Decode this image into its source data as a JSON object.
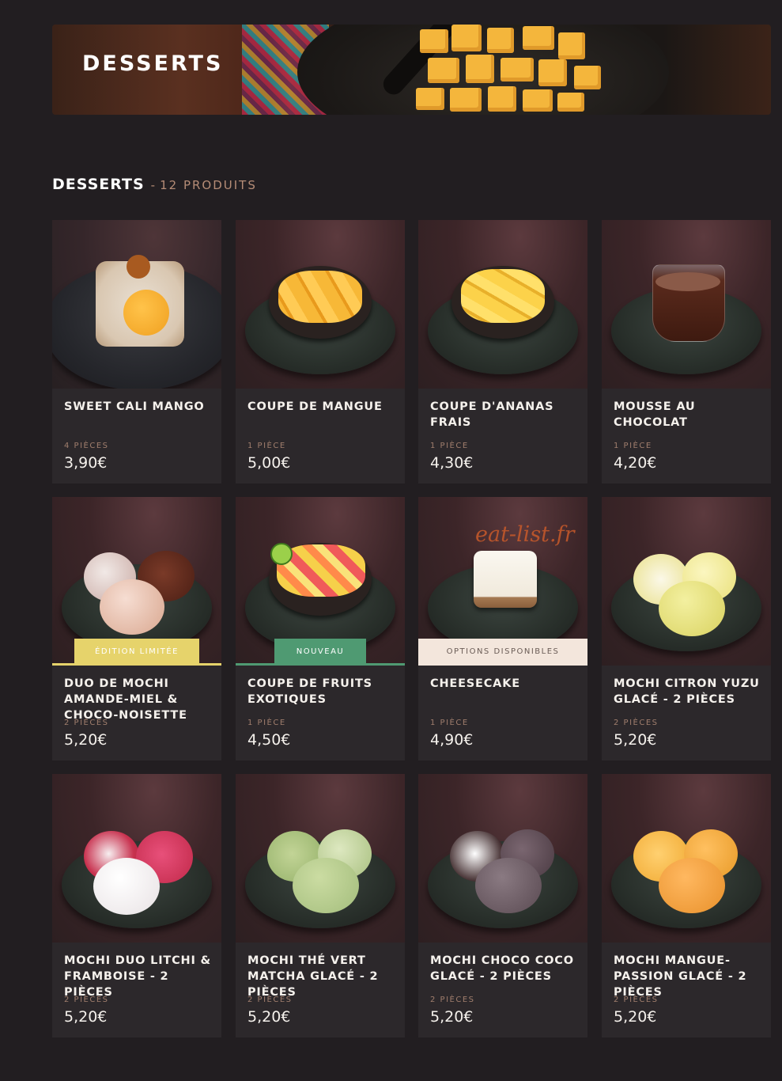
{
  "banner": {
    "title": "DESSERTS"
  },
  "section": {
    "title": "DESSERTS",
    "separator": "-",
    "count": "12 PRODUITS"
  },
  "watermark": "eat-list.fr",
  "products": [
    {
      "name": "SWEET CALI MANGO",
      "qty": "4 PIÈCES",
      "price": "3,90€"
    },
    {
      "name": "COUPE DE MANGUE",
      "qty": "1 PIÈCE",
      "price": "5,00€"
    },
    {
      "name": "COUPE D'ANANAS FRAIS",
      "qty": "1 PIÈCE",
      "price": "4,30€"
    },
    {
      "name": "MOUSSE AU CHOCOLAT",
      "qty": "1 PIÈCE",
      "price": "4,20€"
    },
    {
      "name": "DUO DE MOCHI AMANDE-MIEL & CHOCO-NOISETTE",
      "qty": "2 PIÈCES",
      "price": "5,20€",
      "badge": "ÉDITION LIMITÉE",
      "badge_color": "#e6d36b",
      "badge_text_color": "#ffffff"
    },
    {
      "name": "COUPE DE FRUITS EXOTIQUES",
      "qty": "1 PIÈCE",
      "price": "4,50€",
      "badge": "NOUVEAU",
      "badge_color": "#4f9a72",
      "badge_text_color": "#ffffff"
    },
    {
      "name": "CHEESECAKE",
      "qty": "1 PIÈCE",
      "price": "4,90€",
      "badge": "OPTIONS DISPONIBLES",
      "badge_color": "#f3e6dc",
      "badge_text_color": "#6a5c56"
    },
    {
      "name": "MOCHI CITRON YUZU GLACÉ - 2 PIÈCES",
      "qty": "2 PIÈCES",
      "price": "5,20€"
    },
    {
      "name": "MOCHI DUO LITCHI & FRAMBOISE - 2 PIÈCES",
      "qty": "2 PIÈCES",
      "price": "5,20€"
    },
    {
      "name": "MOCHI THÉ VERT MATCHA GLACÉ - 2 PIÈCES",
      "qty": "2 PIÈCES",
      "price": "5,20€"
    },
    {
      "name": "MOCHI CHOCO COCO GLACÉ - 2 PIÈCES",
      "qty": "2 PIÈCES",
      "price": "5,20€"
    },
    {
      "name": "MOCHI MANGUE-PASSION GLACÉ - 2 PIÈCES",
      "qty": "2 PIÈCES",
      "price": "5,20€"
    }
  ]
}
